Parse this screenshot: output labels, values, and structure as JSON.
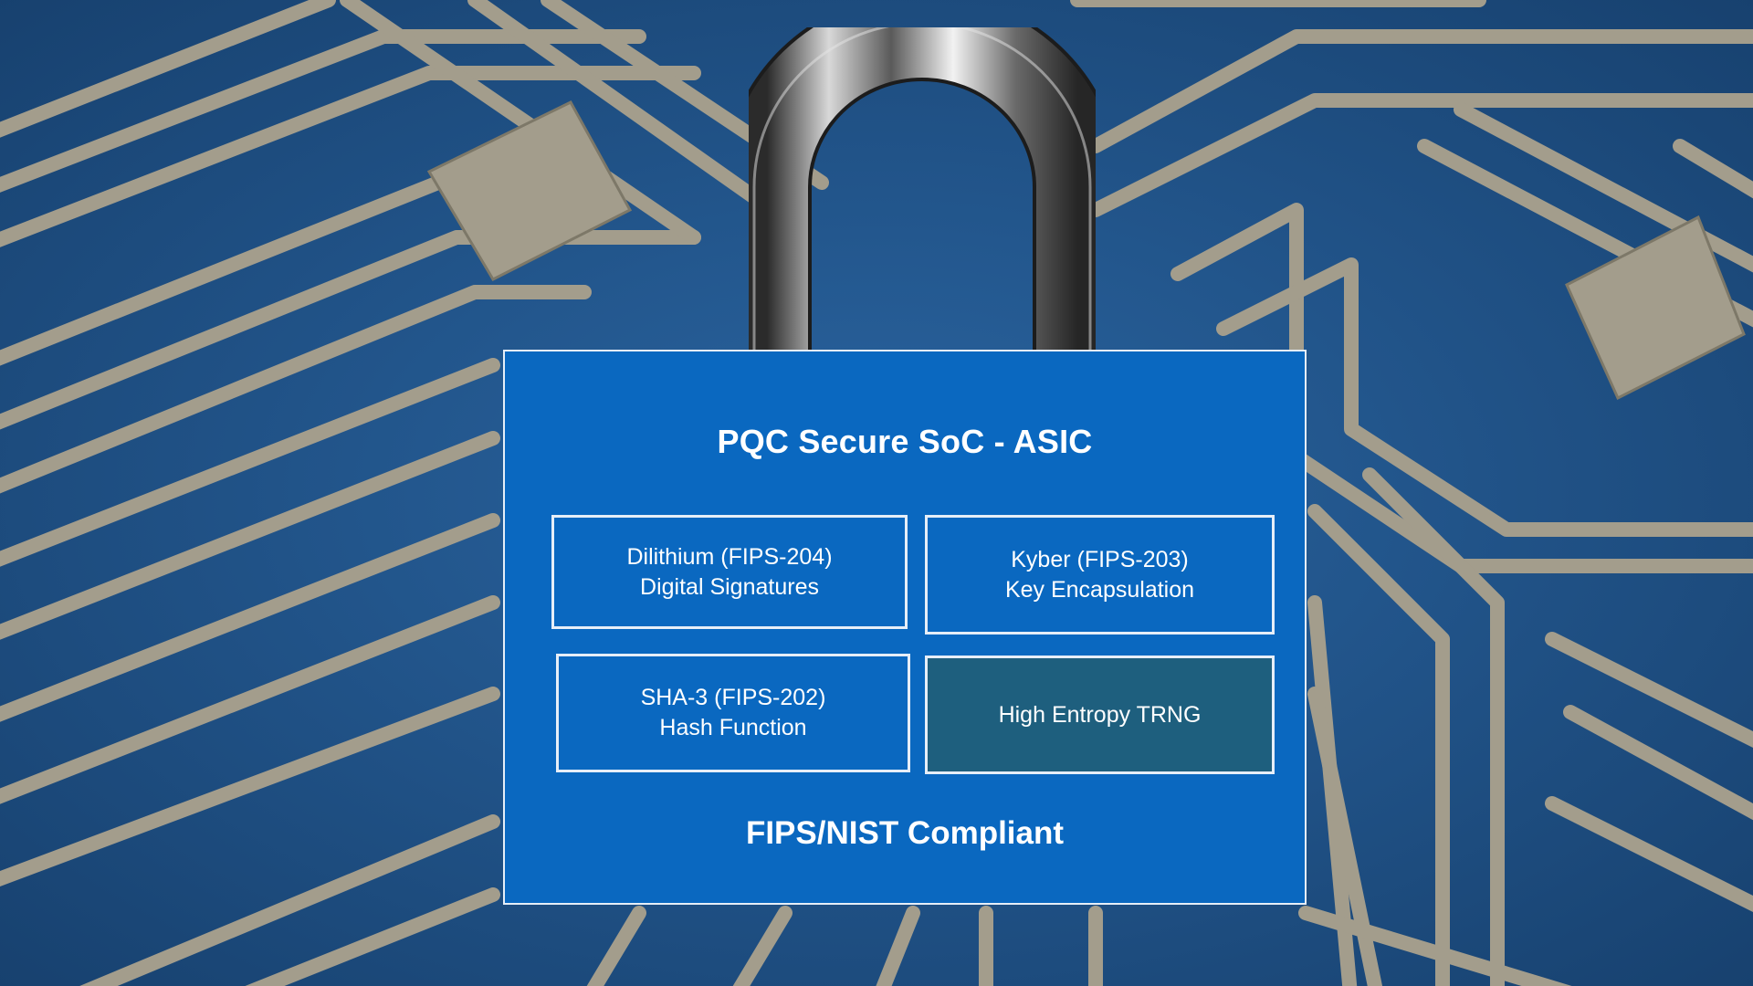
{
  "background": {
    "description_icon": "circuit-board-icon",
    "board_color": "#1d4f86",
    "trace_color": "#a39d8c"
  },
  "padlock": {
    "title": "PQC Secure SoC - ASIC",
    "footer": "FIPS/NIST Compliant",
    "body_color": "#0a68c0",
    "modules": [
      {
        "line1": "Dilithium (FIPS-204)",
        "line2": "Digital Signatures"
      },
      {
        "line1": "Kyber (FIPS-203)",
        "line2": "Key Encapsulation"
      },
      {
        "line1": "SHA-3 (FIPS-202)",
        "line2": "Hash Function"
      },
      {
        "line1": "High Entropy TRNG",
        "line2": ""
      }
    ],
    "trng_color": "#1e5f7e"
  }
}
